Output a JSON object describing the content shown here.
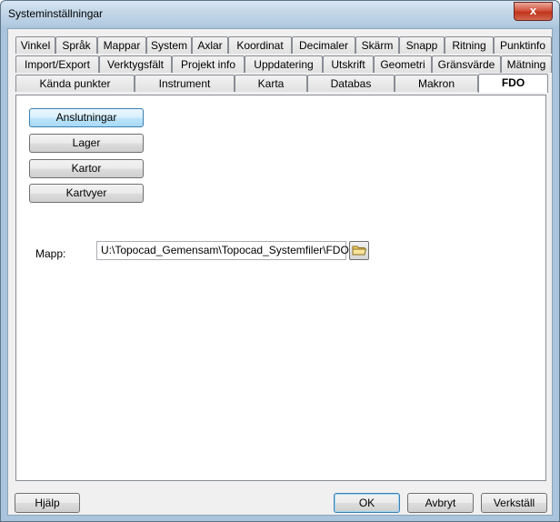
{
  "window": {
    "title": "Systeminställningar",
    "close_label": "x"
  },
  "tabs": {
    "row1": [
      "Vinkel",
      "Språk",
      "Mappar",
      "System",
      "Axlar",
      "Koordinat",
      "Decimaler",
      "Skärm",
      "Snapp",
      "Ritning",
      "Punktinfo"
    ],
    "row2": [
      "Import/Export",
      "Verktygsfält",
      "Projekt info",
      "Uppdatering",
      "Utskrift",
      "Geometri",
      "Gränsvärde",
      "Mätning"
    ],
    "row3": [
      "Kända punkter",
      "Instrument",
      "Karta",
      "Databas",
      "Makron",
      "FDO"
    ],
    "active": "FDO"
  },
  "fdo": {
    "buttons": [
      "Anslutningar",
      "Lager",
      "Kartor",
      "Kartvyer"
    ],
    "mapp_label": "Mapp:",
    "mapp_value": "U:\\Topocad_Gemensam\\Topocad_Systemfiler\\FDO\\"
  },
  "footer": {
    "help": "Hjälp",
    "ok": "OK",
    "cancel": "Avbryt",
    "apply": "Verkställ"
  }
}
